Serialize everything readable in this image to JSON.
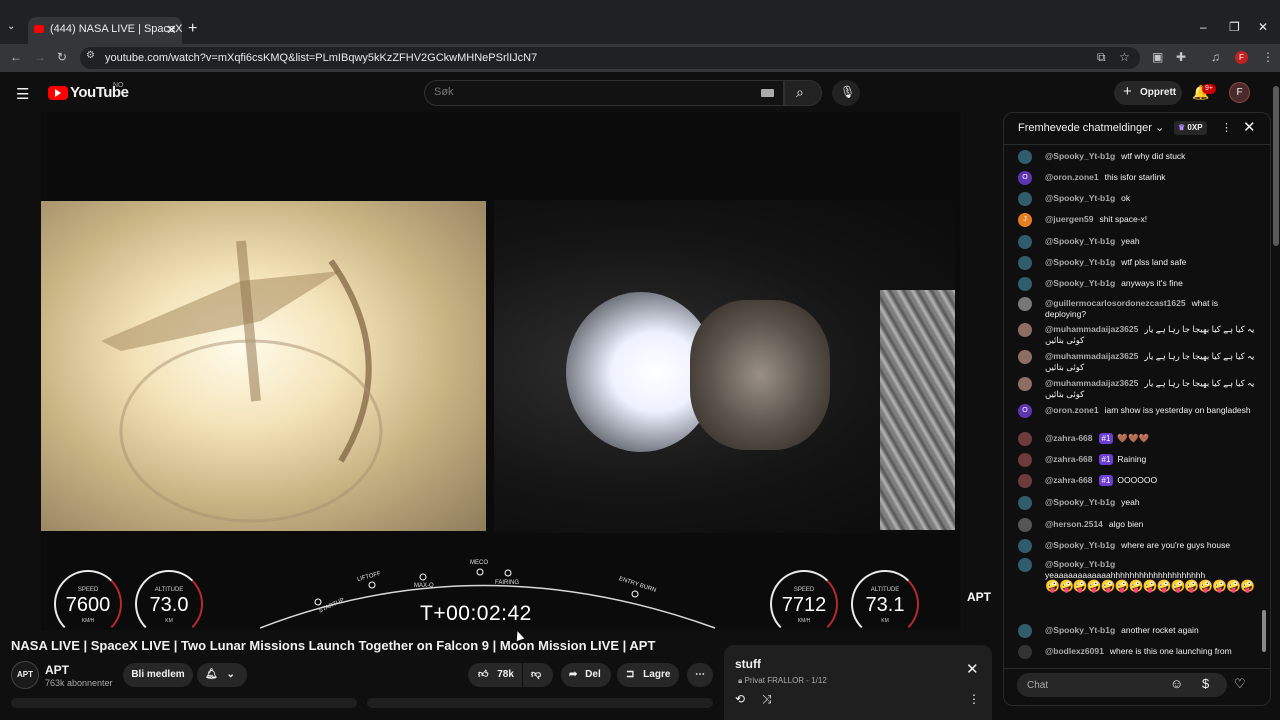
{
  "browser": {
    "tab_title": "(444) NASA LIVE | SpaceX LI",
    "url": "youtube.com/watch?v=mXqfi6csKMQ&list=PLmIBqwy5kKzZFHV2GCkwMHNePSrlIJcN7",
    "profile_initial": "F"
  },
  "masthead": {
    "logo_text": "YouTube",
    "country_code": "NO",
    "search_placeholder": "Søk",
    "create_label": "Opprett",
    "notification_count": "9+",
    "avatar_initial": "F"
  },
  "player": {
    "left_gauge": {
      "speed_caption": "SPEED",
      "speed_value": "7600",
      "speed_unit": "KM/H",
      "alt_caption": "ALTITUDE",
      "alt_value": "73.0",
      "alt_unit": "KM"
    },
    "right_gauge": {
      "speed_caption": "SPEED",
      "speed_value": "7712",
      "speed_unit": "KM/H",
      "alt_caption": "ALTITUDE",
      "alt_value": "73.1",
      "alt_unit": "KM"
    },
    "milestones": [
      "STARTUP",
      "LIFTOFF",
      "MAX-Q",
      "MECO",
      "FAIRING",
      "ENTRY BURN"
    ],
    "mission_clock": "T+00:02:42",
    "channel_bug": "APT"
  },
  "video": {
    "title": "NASA LIVE | SpaceX LIVE | Two Lunar Missions Launch Together on Falcon 9 | Moon Mission LIVE | APT",
    "channel_name": "APT",
    "channel_avatar": "APT",
    "subscribers": "763k abonnenter",
    "join_label": "Bli medlem",
    "likes": "78k",
    "share_label": "Del",
    "save_label": "Lagre"
  },
  "playlist": {
    "title": "stuff",
    "privacy": "Privat",
    "owner_progress": "FRALLOR - 1/12"
  },
  "chat": {
    "header": "Fremhevede chatmeldinger",
    "xp_badge": "0XP",
    "input_placeholder": "Chat",
    "messages": [
      {
        "author": "@Spooky_Yt-b1g",
        "text": "wtf why did stuck",
        "avatar": "",
        "avatar_color": "#2f5d6b"
      },
      {
        "author": "@oron.zone1",
        "text": "this isfor starlink",
        "avatar": "O",
        "avatar_color": "#5e35b1"
      },
      {
        "author": "@Spooky_Yt-b1g",
        "text": "ok",
        "avatar": "",
        "avatar_color": "#2f5d6b"
      },
      {
        "author": "@juergen59",
        "text": "shit space-x!",
        "avatar": "J",
        "avatar_color": "#e67e22"
      },
      {
        "author": "@Spooky_Yt-b1g",
        "text": "yeah",
        "avatar": "",
        "avatar_color": "#2f5d6b"
      },
      {
        "author": "@Spooky_Yt-b1g",
        "text": "wtf plss land safe",
        "avatar": "",
        "avatar_color": "#2f5d6b"
      },
      {
        "author": "@Spooky_Yt-b1g",
        "text": "anyways it's fine",
        "avatar": "",
        "avatar_color": "#2f5d6b"
      },
      {
        "author": "@guillermocarlosordonezcast1625",
        "text": "what is deploying?",
        "avatar": "",
        "avatar_color": "#777777"
      },
      {
        "author": "@muhammadaijaz3625",
        "text": "یہ کیا ہے کیا بھیجا جا رہا ہے یار کوئی بتائیں",
        "avatar": "",
        "avatar_color": "#8d6e63"
      },
      {
        "author": "@muhammadaijaz3625",
        "text": "یہ کیا ہے کیا بھیجا جا رہا ہے یار کوئی بتائیں",
        "avatar": "",
        "avatar_color": "#8d6e63"
      },
      {
        "author": "@muhammadaijaz3625",
        "text": "یہ کیا ہے کیا بھیجا جا رہا ہے یار کوئی بتائیں",
        "avatar": "",
        "avatar_color": "#8d6e63"
      },
      {
        "author": "@oron.zone1",
        "text": "iam show iss yesterday on bangladesh",
        "avatar": "O",
        "avatar_color": "#5e35b1"
      },
      {
        "author": "@zahra-668",
        "badge": "#1",
        "text": "🤎🤎🤎",
        "avatar": "",
        "avatar_color": "#6d3b3b"
      },
      {
        "author": "@zahra-668",
        "badge": "#1",
        "text": "Raining",
        "avatar": "",
        "avatar_color": "#6d3b3b"
      },
      {
        "author": "@zahra-668",
        "badge": "#1",
        "text": "OOOOOO",
        "avatar": "",
        "avatar_color": "#6d3b3b"
      },
      {
        "author": "@Spooky_Yt-b1g",
        "text": "yeah",
        "avatar": "",
        "avatar_color": "#2f5d6b"
      },
      {
        "author": "@herson.2514",
        "text": "algo bien",
        "avatar": "",
        "avatar_color": "#555555"
      },
      {
        "author": "@Spooky_Yt-b1g",
        "text": "where are you're guys house",
        "avatar": "",
        "avatar_color": "#2f5d6b"
      },
      {
        "author": "@Spooky_Yt-b1g",
        "text": "yeaaaaaaaaaaaahhhhhhhhhhhhhhhhhhhh",
        "avatar": "",
        "avatar_color": "#2f5d6b",
        "emojis": "🤪🤪🤪🤪🤪🤪🤪🤪🤪🤪🤪🤪🤪🤪🤪"
      },
      {
        "author": "@Spooky_Yt-b1g",
        "text": "another rocket again",
        "avatar": "",
        "avatar_color": "#2f5d6b"
      },
      {
        "author": "@bodlexz6091",
        "text": "where is this one launching from",
        "avatar": "",
        "avatar_color": "#333333"
      }
    ]
  }
}
